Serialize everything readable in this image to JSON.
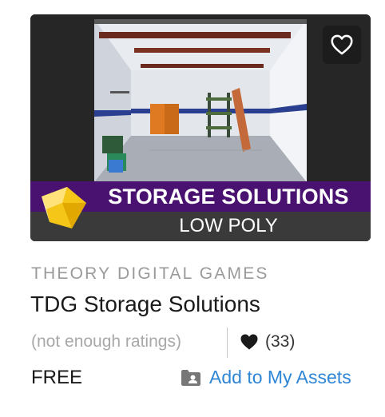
{
  "product": {
    "banner_title": "STORAGE SOLUTIONS",
    "banner_subtitle": "LOW POLY",
    "publisher": "THEORY DIGITAL GAMES",
    "title": "TDG Storage Solutions",
    "ratings_text": "(not enough ratings)",
    "favorites_count": "(33)",
    "price": "FREE",
    "add_label": "Add to My Assets"
  },
  "icons": {
    "favorite": "heart-outline-icon",
    "favorites_count": "heart-filled-icon",
    "add": "folder-user-icon",
    "logo": "gem-logo-icon"
  },
  "colors": {
    "link": "#2f86d6",
    "banner_purple": "#4a1270",
    "banner_gray": "#3a3a3a",
    "logo_yellow": "#f5c518"
  }
}
